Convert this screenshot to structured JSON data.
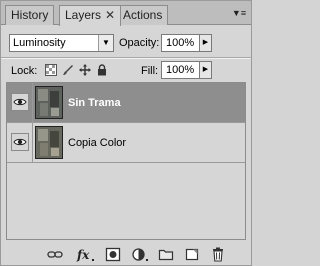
{
  "tabs": [
    {
      "label": "History"
    },
    {
      "label": "Layers"
    },
    {
      "label": "Actions"
    }
  ],
  "blend_mode": {
    "value": "Luminosity"
  },
  "opacity": {
    "label": "Opacity:",
    "value": "100%"
  },
  "lock": {
    "label": "Lock:"
  },
  "fill": {
    "label": "Fill:",
    "value": "100%"
  },
  "layers": [
    {
      "name": "Sin Trama",
      "selected": true
    },
    {
      "name": "Copia Color",
      "selected": false
    }
  ],
  "icons": [
    "eye-icon",
    "link-layers-icon",
    "fx-icon",
    "mask-icon",
    "adjustment-layer-icon",
    "group-icon",
    "new-layer-icon",
    "trash-icon"
  ]
}
